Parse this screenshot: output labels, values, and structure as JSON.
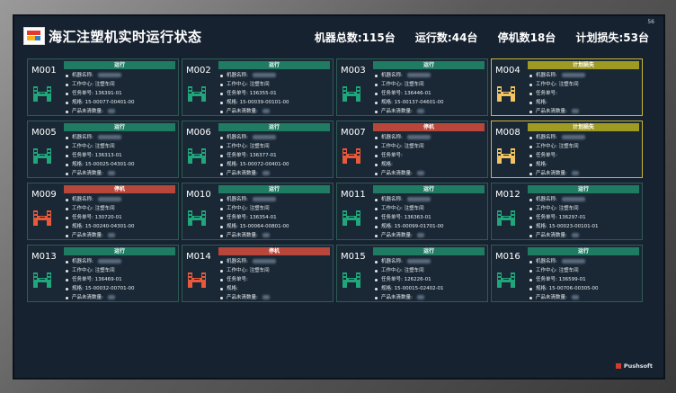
{
  "header": {
    "title": "海汇注塑机实时运行状态",
    "page_number": "56",
    "stats": {
      "total": "机器总数:115台",
      "running": "运行数:44台",
      "stopped": "停机数18台",
      "planned_loss": "计划损失:53台"
    }
  },
  "labels": {
    "machine_name": "机器名称:",
    "work_center": "工作中心:",
    "task_no": "任务单号:",
    "spec": "规格:",
    "unreported": "产品未清数量:"
  },
  "status_colors": {
    "run": "#1f7b62",
    "stop": "#b8463a",
    "plan": "#9e9a22",
    "icon_run": "#1fa67a",
    "icon_stop": "#e8583a",
    "icon_plan": "#f2c462"
  },
  "machines": [
    {
      "id": "M001",
      "status": "运行",
      "kind": "run",
      "work_center": "注塑车间",
      "task_no": "136391-01",
      "spec": "15-00077-00401-00",
      "icon": "injection-machine-icon"
    },
    {
      "id": "M002",
      "status": "运行",
      "kind": "run",
      "work_center": "注塑车间",
      "task_no": "136355-01",
      "spec": "15-00039-00101-00",
      "icon": "injection-machine-icon"
    },
    {
      "id": "M003",
      "status": "运行",
      "kind": "run",
      "work_center": "注塑车间",
      "task_no": "136446-01",
      "spec": "15-00137-04601-00",
      "icon": "injection-machine-icon"
    },
    {
      "id": "M004",
      "status": "计划损失",
      "kind": "plan",
      "work_center": "注塑车间",
      "task_no": "",
      "spec": "",
      "icon": "injection-machine-icon"
    },
    {
      "id": "M005",
      "status": "运行",
      "kind": "run",
      "work_center": "注塑车间",
      "task_no": "136313-01",
      "spec": "15-00025-04301-00",
      "icon": "injection-machine-icon"
    },
    {
      "id": "M006",
      "status": "运行",
      "kind": "run",
      "work_center": "注塑车间",
      "task_no": "136377-01",
      "spec": "15-00072-00401-00",
      "icon": "injection-machine-icon"
    },
    {
      "id": "M007",
      "status": "停机",
      "kind": "stop",
      "work_center": "注塑车间",
      "task_no": "",
      "spec": "",
      "icon": "injection-machine-icon"
    },
    {
      "id": "M008",
      "status": "计划损失",
      "kind": "plan",
      "work_center": "注塑车间",
      "task_no": "",
      "spec": "",
      "icon": "injection-machine-icon"
    },
    {
      "id": "M009",
      "status": "停机",
      "kind": "stop",
      "work_center": "注塑车间",
      "task_no": "130720-01",
      "spec": "15-00240-04301-00",
      "icon": "injection-machine-icon"
    },
    {
      "id": "M010",
      "status": "运行",
      "kind": "run",
      "work_center": "注塑车间",
      "task_no": "136354-01",
      "spec": "15-00064-00801-00",
      "icon": "injection-machine-icon"
    },
    {
      "id": "M011",
      "status": "运行",
      "kind": "run",
      "work_center": "注塑车间",
      "task_no": "136363-01",
      "spec": "15-00099-01701-00",
      "icon": "injection-machine-icon"
    },
    {
      "id": "M012",
      "status": "运行",
      "kind": "run",
      "work_center": "注塑车间",
      "task_no": "136297-01",
      "spec": "15-00023-00101-01",
      "icon": "injection-machine-icon"
    },
    {
      "id": "M013",
      "status": "运行",
      "kind": "run",
      "work_center": "注塑车间",
      "task_no": "136469-01",
      "spec": "15-00032-00701-00",
      "icon": "injection-machine-icon"
    },
    {
      "id": "M014",
      "status": "停机",
      "kind": "stop",
      "work_center": "注塑车间",
      "task_no": "",
      "spec": "",
      "icon": "injection-machine-icon"
    },
    {
      "id": "M015",
      "status": "运行",
      "kind": "run",
      "work_center": "注塑车间",
      "task_no": "126226-01",
      "spec": "15-00015-02402-01",
      "icon": "injection-machine-icon"
    },
    {
      "id": "M016",
      "status": "运行",
      "kind": "run",
      "work_center": "注塑车间",
      "task_no": "136599-01",
      "spec": "15-00706-00305-00",
      "icon": "injection-machine-icon"
    }
  ],
  "footer": {
    "brand": "Pushsoft"
  }
}
